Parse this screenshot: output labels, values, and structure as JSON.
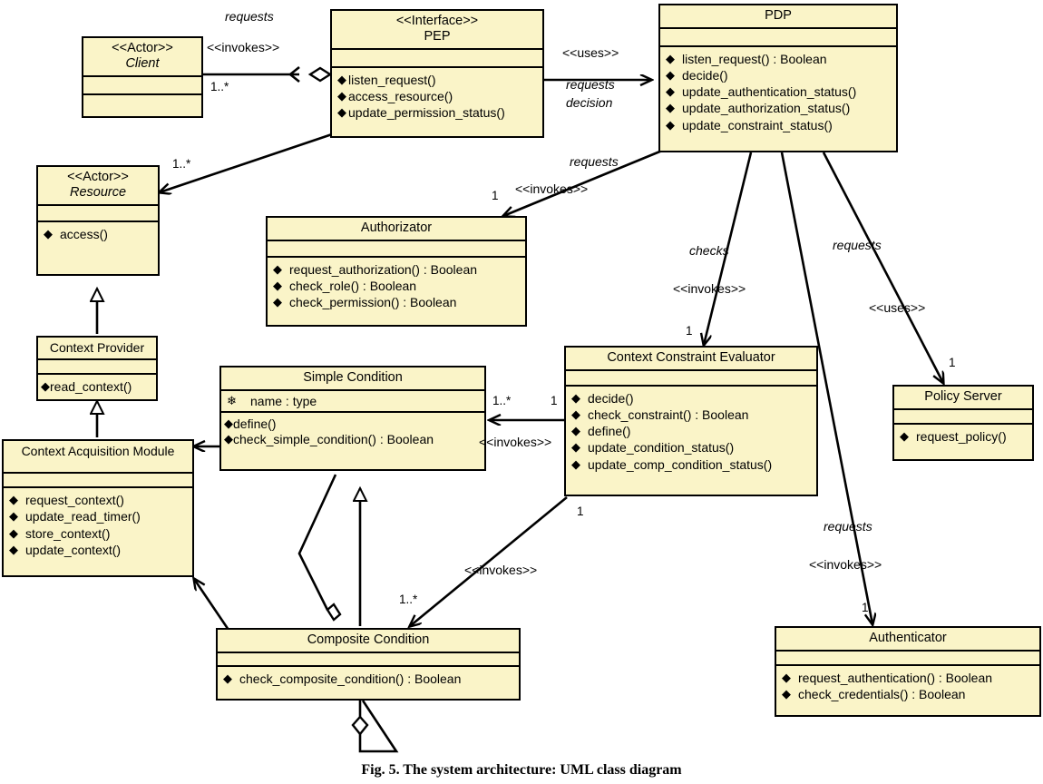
{
  "figure": {
    "caption": "Fig. 5.   The system architecture: UML class diagram",
    "fill_color": "#faf4c8",
    "line_color": "#000000"
  },
  "classes": {
    "client": {
      "stereotype": "<<Actor>>",
      "name": "Client",
      "attributes": [],
      "operations": []
    },
    "pep": {
      "stereotype": "<<Interface>>",
      "name": "PEP",
      "attributes": [],
      "operations": [
        "listen_request()",
        "access_resource()",
        "update_permission_status()"
      ]
    },
    "pdp": {
      "stereotype": "",
      "name": "PDP",
      "attributes": [],
      "operations": [
        "listen_request() : Boolean",
        "decide()",
        "update_authentication_status()",
        "update_authorization_status()",
        "update_constraint_status()"
      ]
    },
    "resource": {
      "stereotype": "<<Actor>>",
      "name": "Resource",
      "attributes": [],
      "operations": [
        "access()"
      ]
    },
    "authorizator": {
      "stereotype": "",
      "name": "Authorizator",
      "attributes": [],
      "operations": [
        "request_authorization() : Boolean",
        "check_role() : Boolean",
        "check_permission() : Boolean"
      ]
    },
    "context_provider": {
      "stereotype": "",
      "name": "Context Provider",
      "attributes": [],
      "operations": [
        "read_context()"
      ]
    },
    "context_acquisition_module": {
      "stereotype": "",
      "name": "Context Acquisition Module",
      "attributes": [],
      "operations": [
        "request_context()",
        "update_read_timer()",
        "store_context()",
        "update_context()"
      ]
    },
    "simple_condition": {
      "stereotype": "",
      "name": "Simple Condition",
      "attributes": [
        "name : type"
      ],
      "operations": [
        "define()",
        "check_simple_condition() : Boolean"
      ]
    },
    "context_constraint_evaluator": {
      "stereotype": "",
      "name": "Context Constraint Evaluator",
      "attributes": [],
      "operations": [
        "decide()",
        "check_constraint() : Boolean",
        "define()",
        "update_condition_status()",
        "update_comp_condition_status()"
      ]
    },
    "policy_server": {
      "stereotype": "",
      "name": "Policy Server",
      "attributes": [],
      "operations": [
        "request_policy()"
      ]
    },
    "authenticator": {
      "stereotype": "",
      "name": "Authenticator",
      "attributes": [],
      "operations": [
        "request_authentication() : Boolean",
        "check_credentials() : Boolean"
      ]
    },
    "composite_condition": {
      "stereotype": "",
      "name": "Composite Condition",
      "attributes": [],
      "operations": [
        "check_composite_condition() : Boolean"
      ]
    }
  },
  "edge_labels": {
    "client_pep_requests": "requests",
    "client_pep_invokes": "<<invokes>>",
    "client_pep_mult": "1..*",
    "pep_pdp_uses": "<<uses>>",
    "pep_pdp_requests": "requests",
    "pep_pdp_decision": "decision",
    "pep_resource_mult": "1..*",
    "pdp_authorizator_requests": "requests",
    "pdp_authorizator_invokes": "<<invokes>>",
    "pdp_authorizator_mult": "1",
    "pdp_evaluator_checks": "checks",
    "pdp_evaluator_invokes": "<<invokes>>",
    "pdp_evaluator_mult": "1",
    "pdp_policy_requests": "requests",
    "pdp_policy_uses": "<<uses>>",
    "pdp_policy_mult": "1",
    "pdp_authenticator_requests": "requests",
    "pdp_authenticator_invokes": "<<invokes>>",
    "pdp_authenticator_mult": "1",
    "eval_simple_invokes": "<<invokes>>",
    "eval_simple_mult_src": "1",
    "eval_simple_mult_dst": "1..*",
    "eval_composite_invokes": "<<invokes>>",
    "eval_composite_mult_src": "1",
    "eval_composite_mult_dst": "1..*"
  }
}
